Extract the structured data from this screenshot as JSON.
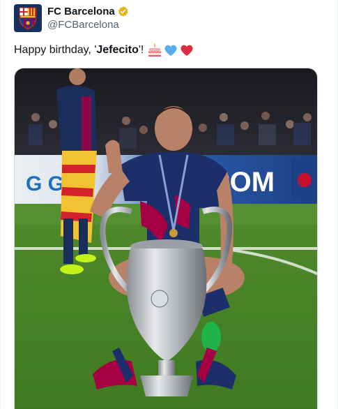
{
  "account": {
    "display_name": "FC Barcelona",
    "handle": "@FCBarcelona",
    "verified": true,
    "avatar_icon": "fc-barcelona-crest-icon"
  },
  "tweet": {
    "text_before": "Happy birthday, '",
    "text_bold": "Jefecito",
    "text_after": "'!",
    "emojis": [
      "birthday-cake-icon",
      "blue-heart-icon",
      "red-heart-icon"
    ]
  },
  "media": {
    "description_icon": "photo-icon",
    "banner_left": "G GA",
    "banner_right": "POM"
  },
  "colors": {
    "verified_gold": "#e2b719",
    "text_primary": "#0f1419",
    "text_secondary": "#536471",
    "barca_blue": "#16315f",
    "barca_red": "#a50044"
  }
}
